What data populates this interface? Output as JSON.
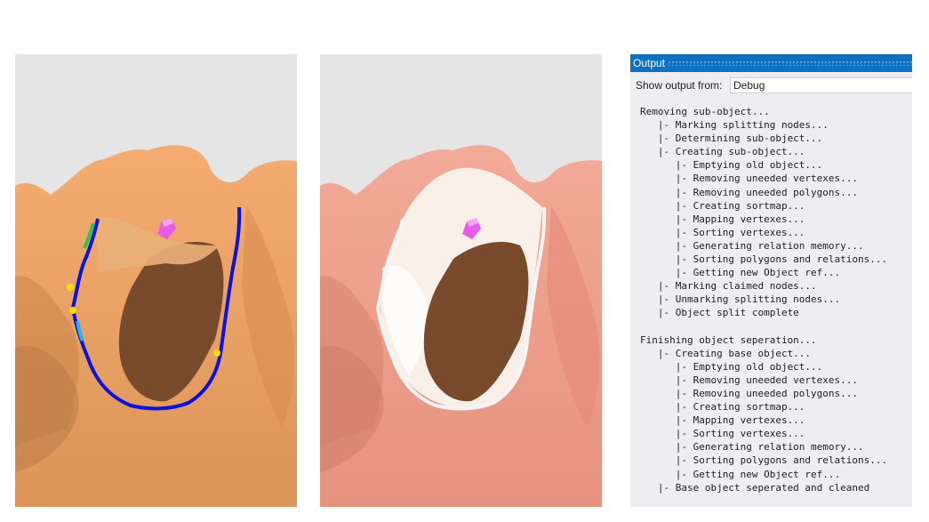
{
  "output": {
    "title": "Output",
    "show_from_label": "Show output from:",
    "source": "Debug",
    "lines": [
      "Removing sub-object...",
      "   |- Marking splitting nodes...",
      "   |- Determining sub-object...",
      "   |- Creating sub-object...",
      "      |- Emptying old object...",
      "      |- Removing uneeded vertexes...",
      "      |- Removing uneeded polygons...",
      "      |- Creating sortmap...",
      "      |- Mapping vertexes...",
      "      |- Sorting vertexes...",
      "      |- Generating relation memory...",
      "      |- Sorting polygons and relations...",
      "      |- Getting new Object ref...",
      "   |- Marking claimed nodes...",
      "   |- Unmarking splitting nodes...",
      "   |- Object split complete",
      "",
      "Finishing object seperation...",
      "   |- Creating base object...",
      "      |- Emptying old object...",
      "      |- Removing uneeded vertexes...",
      "      |- Removing uneeded polygons...",
      "      |- Creating sortmap...",
      "      |- Mapping vertexes...",
      "      |- Sorting vertexes...",
      "      |- Generating relation memory...",
      "      |- Sorting polygons and relations...",
      "      |- Getting new Object ref...",
      "   |- Base object seperated and cleaned"
    ]
  },
  "colors": {
    "viewport_bg": "#e5e5e5",
    "mesh_orange": "#f2a56a",
    "mesh_pink": "#f2a08e",
    "hole_brown": "#7a4a2c",
    "selected_white": "#f8efe8",
    "border_blue": "#0a14d8",
    "marker_magenta": "#e85ce8",
    "marker_yellow": "#f2e100",
    "title_bar": "#0e70c0",
    "panel_bg": "#eeeef2"
  }
}
